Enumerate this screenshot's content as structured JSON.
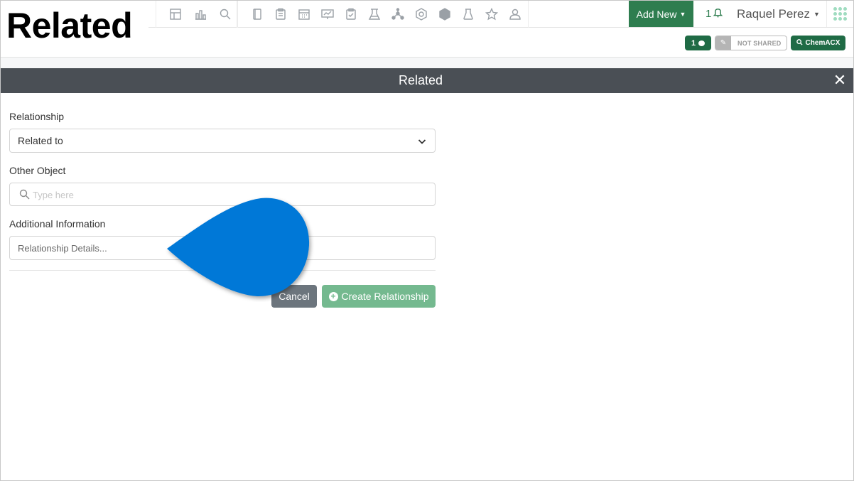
{
  "overlay_title": "Related",
  "topnav": {
    "icons_group1": [
      "layout-icon",
      "bar-chart-icon",
      "search-icon"
    ],
    "icons_group2": [
      "notebook-icon",
      "clipboard-icon",
      "calendar-icon",
      "presentation-icon",
      "checklist-icon",
      "lab-flask-icon",
      "molecule-icon",
      "hexagon-icon",
      "cube-icon",
      "beaker-icon",
      "star-icon",
      "user-icon"
    ],
    "add_new": "Add New",
    "notifications_count": "1",
    "user_name": "Raquel Perez"
  },
  "subbar": {
    "comment_count": "1",
    "sharing_status": "NOT SHARED",
    "chemacx_label": "ChemACX"
  },
  "modal": {
    "title": "Related",
    "close": "✕"
  },
  "form": {
    "relationship_label": "Relationship",
    "relationship_value": "Related to",
    "other_object_label": "Other Object",
    "other_object_placeholder": "Type here",
    "additional_info_label": "Additional Information",
    "additional_info_placeholder": "Relationship Details...",
    "cancel_label": "Cancel",
    "create_label": "Create Relationship"
  },
  "colors": {
    "primary_green": "#2e7d4f",
    "dark_green": "#1f6b45",
    "modal_header": "#4a4f55",
    "pointer_blue": "#0078d7",
    "create_button": "#74b98f",
    "cancel_button": "#6c757d"
  }
}
